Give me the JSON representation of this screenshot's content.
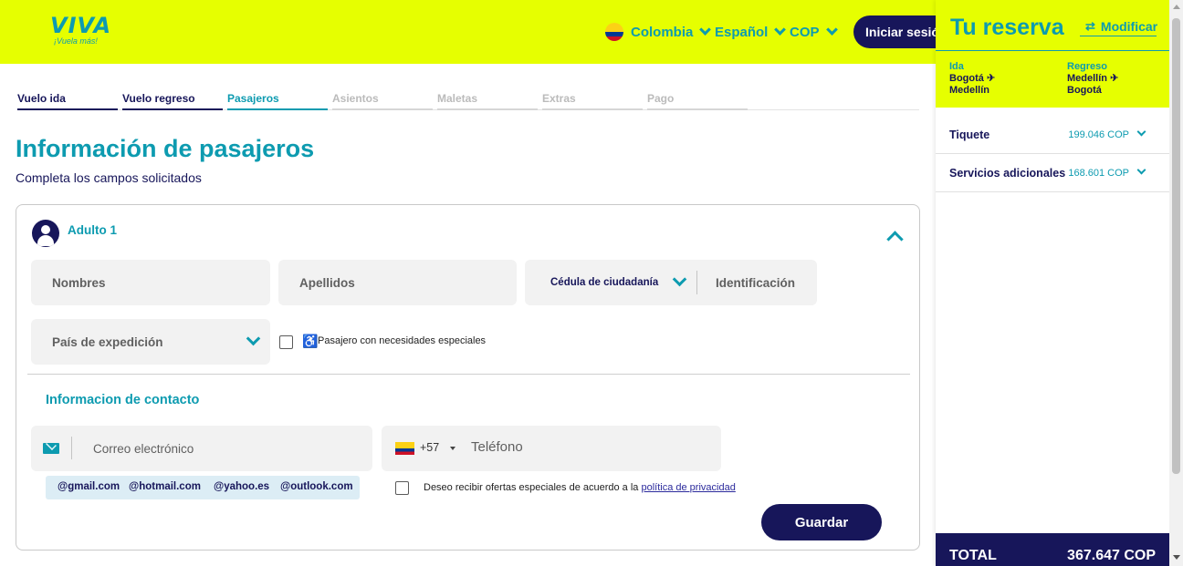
{
  "header": {
    "logo_text": "VIVA",
    "logo_tagline": "¡Vuela más!",
    "country": "Colombia",
    "language": "Español",
    "currency": "COP",
    "login_label": "Iniciar sesión",
    "background_color": "#e6ff00",
    "accent_color": "#0d9bb0"
  },
  "steps": [
    {
      "label": "Vuelo ida",
      "state": "done"
    },
    {
      "label": "Vuelo regreso",
      "state": "done"
    },
    {
      "label": "Pasajeros",
      "state": "active"
    },
    {
      "label": "Asientos",
      "state": "pending"
    },
    {
      "label": "Maletas",
      "state": "pending"
    },
    {
      "label": "Extras",
      "state": "pending"
    },
    {
      "label": "Pago",
      "state": "pending"
    }
  ],
  "main": {
    "title": "Información de pasajeros",
    "subtitle": "Completa los campos solicitados"
  },
  "passenger": {
    "title": "Adulto 1",
    "fields": {
      "nombres_placeholder": "Nombres",
      "apellidos_placeholder": "Apellidos",
      "doc_type": "Cédula de ciudadanía",
      "identificacion_placeholder": "Identificación",
      "pais_placeholder": "País de expedición"
    },
    "special_needs_label": "Pasajero con necesidades especiales"
  },
  "contact": {
    "title": "Informacion de contacto",
    "email_placeholder": "Correo electrónico",
    "phone_prefix": "+57",
    "phone_placeholder": "Teléfono",
    "email_suggestions": [
      "@gmail.com",
      "@hotmail.com",
      "@yahoo.es",
      "@outlook.com"
    ],
    "offers_text": "Deseo recibir ofertas especiales de acuerdo a la",
    "privacy_link": "política de privacidad",
    "save_label": "Guardar"
  },
  "reservation": {
    "title": "Tu reserva",
    "modify_label": "Modificar",
    "outbound": {
      "label": "Ida",
      "from": "Bogotá",
      "to": "Medellín"
    },
    "inbound": {
      "label": "Regreso",
      "from": "Medellín",
      "to": "Bogotá"
    },
    "ticket": {
      "label": "Tiquete",
      "amount": "199.046 COP"
    },
    "extras": {
      "label": "Servicios adicionales",
      "amount": "168.601 COP"
    },
    "total_label": "TOTAL",
    "total_amount": "367.647 COP"
  },
  "icons": {
    "plane": "✈",
    "modify": "⇄",
    "accessibility": "♿"
  }
}
